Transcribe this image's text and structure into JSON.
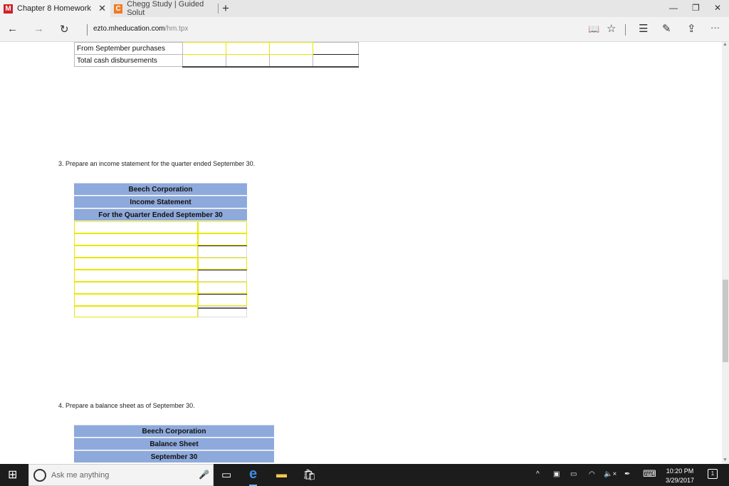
{
  "browser": {
    "tabs": [
      {
        "title": "Chapter 8 Homework",
        "favicon": "M",
        "favicon_color": "#d02027",
        "close": "✕"
      },
      {
        "title": "Chegg Study | Guided Solut",
        "favicon": "C",
        "favicon_color": "#f07b22"
      }
    ],
    "new_tab": "+",
    "window": {
      "minimize": "—",
      "restore": "❐",
      "close": "✕"
    },
    "nav": {
      "back": "←",
      "forward": "→",
      "refresh": "↻"
    },
    "url_domain": "ezto.mheducation.com",
    "url_path": "/hm.tpx",
    "toolbar": {
      "reading_view": "📖",
      "favorite": "☆",
      "hub": "☰",
      "notes": "✎",
      "share": "⇪",
      "more": "···"
    }
  },
  "cash_table": {
    "rows": [
      {
        "label": "From September purchases"
      },
      {
        "label": "Total cash disbursements"
      }
    ]
  },
  "q3": {
    "prompt": "3.  Prepare an income statement for the quarter ended September 30.",
    "header": [
      "Beech Corporation",
      "Income Statement",
      "For the Quarter Ended September 30"
    ]
  },
  "q4": {
    "prompt": "4.  Prepare a balance sheet as of September 30.",
    "header": [
      "Beech Corporation",
      "Balance Sheet",
      "September 30"
    ]
  },
  "taskbar": {
    "start": "⊞",
    "search_placeholder": "Ask me anything",
    "mic": "🎤",
    "task_view": "▭",
    "edge": "e",
    "explorer": "▬",
    "store": "🛍",
    "tray": {
      "chevron": "^",
      "net1": "▣",
      "net2": "▭",
      "wifi": "◠",
      "volume": "🔈×",
      "pen": "✒",
      "keyboard": "⌨"
    },
    "time": "10:20 PM",
    "date": "3/29/2017",
    "notifications": "1"
  }
}
